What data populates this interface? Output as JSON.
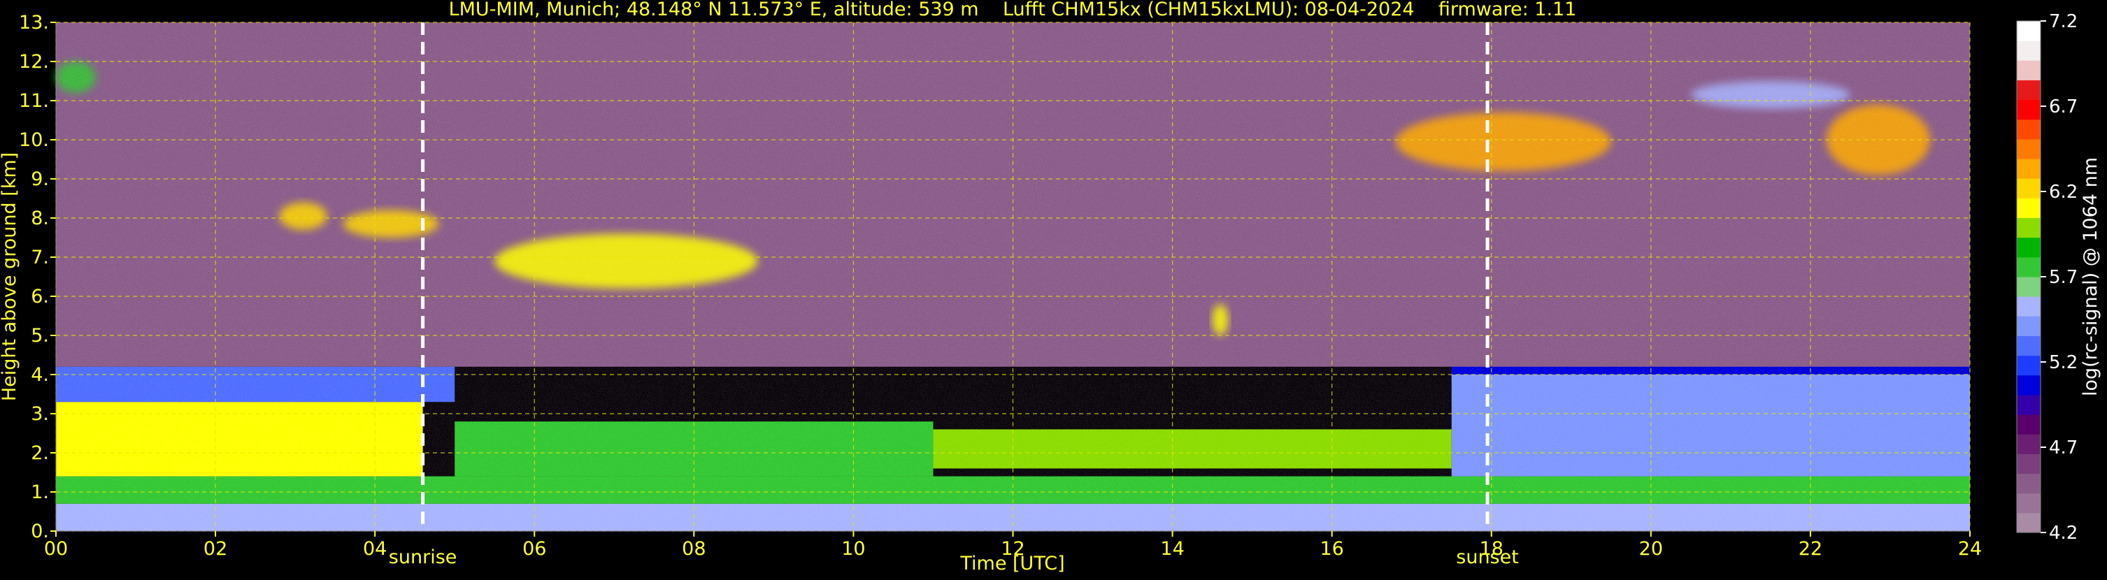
{
  "chart_data": {
    "type": "heatmap",
    "title": "LMU-MIM, Munich; 48.148° N 11.573° E, altitude: 539 m    Lufft CHM15kx (CHM15kxLMU): 08-04-2024    firmware: 1.11",
    "xlabel": "Time [UTC]",
    "ylabel": "Height above ground [km]",
    "xlim": [
      0,
      24
    ],
    "ylim": [
      0,
      13
    ],
    "x_ticks": [
      "00",
      "02",
      "04",
      "06",
      "08",
      "10",
      "12",
      "14",
      "16",
      "18",
      "20",
      "22",
      "24"
    ],
    "y_ticks": [
      "0.",
      "1.",
      "2.",
      "3.",
      "4.",
      "5.",
      "6.",
      "7.",
      "8.",
      "9.",
      "10.",
      "11.",
      "12.",
      "13."
    ],
    "grid": true,
    "markers": [
      {
        "label": "sunrise",
        "x": 4.6
      },
      {
        "label": "sunset",
        "x": 17.95
      }
    ],
    "colorbar": {
      "label": "log(rc-signal) @ 1064 nm",
      "range": [
        4.2,
        7.2
      ],
      "ticks": [
        "4.2",
        "4.7",
        "5.2",
        "5.7",
        "6.2",
        "6.7",
        "7.2"
      ],
      "colors": [
        "#a98ba6",
        "#9a7398",
        "#8a5c8a",
        "#7a3f7c",
        "#6a1f73",
        "#5a006a",
        "#3300aa",
        "#0000dd",
        "#1e3cff",
        "#4f6dff",
        "#7f97ff",
        "#a8b4ff",
        "#7fd27f",
        "#33c833",
        "#00b400",
        "#8cdc00",
        "#ffff00",
        "#ffd700",
        "#ffaa00",
        "#ff7a00",
        "#ff4a00",
        "#ff0000",
        "#e61a1a",
        "#efc4c4",
        "#f4eeee",
        "#ffffff"
      ]
    },
    "background_layers": [
      {
        "x": [
          0,
          24
        ],
        "y": [
          0,
          0.7
        ],
        "value": 5.55
      },
      {
        "x": [
          0,
          24
        ],
        "y": [
          0.7,
          1.4
        ],
        "value": 5.8
      },
      {
        "x": [
          0,
          4.6
        ],
        "y": [
          1.4,
          3.3
        ],
        "value": 6.05
      },
      {
        "x": [
          0,
          5
        ],
        "y": [
          3.3,
          4.2
        ],
        "value": 5.35
      },
      {
        "x": [
          5,
          11
        ],
        "y": [
          1.4,
          2.8
        ],
        "value": 5.8
      },
      {
        "x": [
          11,
          17.5
        ],
        "y": [
          1.6,
          2.6
        ],
        "value": 6.0
      },
      {
        "x": [
          17.5,
          24
        ],
        "y": [
          1.4,
          4.0
        ],
        "value": 5.45
      },
      {
        "x": [
          17.5,
          24
        ],
        "y": [
          4.0,
          5.0
        ],
        "value": 5.05
      },
      {
        "x": [
          0,
          24
        ],
        "y": [
          4.2,
          13
        ],
        "value": 4.45
      }
    ],
    "features": [
      {
        "label": "cloud",
        "x": [
          2.8,
          3.4
        ],
        "y": [
          7.7,
          8.4
        ],
        "value": 6.2
      },
      {
        "label": "cloud",
        "x": [
          3.6,
          4.8
        ],
        "y": [
          7.5,
          8.2
        ],
        "value": 6.2
      },
      {
        "label": "cloud",
        "x": [
          5.5,
          8.8
        ],
        "y": [
          6.2,
          7.6
        ],
        "value": 6.05
      },
      {
        "label": "cloud",
        "x": [
          14.5,
          14.7
        ],
        "y": [
          5.0,
          5.8
        ],
        "value": 6.1
      },
      {
        "label": "cloud",
        "x": [
          16.8,
          19.5
        ],
        "y": [
          9.2,
          10.7
        ],
        "value": 6.3
      },
      {
        "label": "cloud",
        "x": [
          20.5,
          22.5
        ],
        "y": [
          10.8,
          11.5
        ],
        "value": 5.5
      },
      {
        "label": "cloud",
        "x": [
          22.2,
          23.5
        ],
        "y": [
          9.1,
          10.9
        ],
        "value": 6.3
      },
      {
        "label": "cloud",
        "x": [
          0,
          0.5
        ],
        "y": [
          11.2,
          12.0
        ],
        "value": 5.7
      }
    ]
  }
}
